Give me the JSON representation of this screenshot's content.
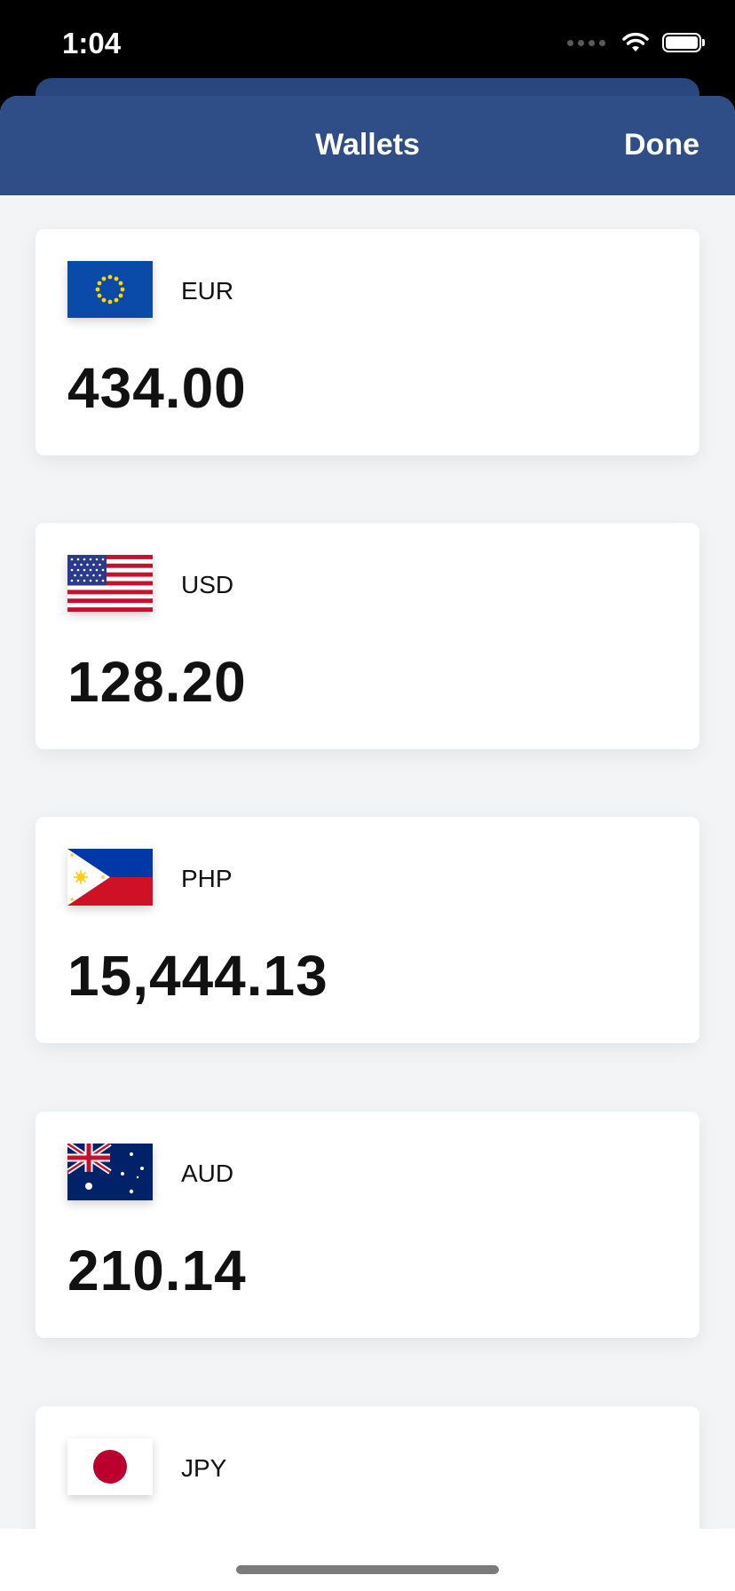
{
  "status_bar": {
    "time": "1:04",
    "icons": [
      "signal-icon",
      "wifi-icon",
      "battery-icon"
    ]
  },
  "nav": {
    "title": "Wallets",
    "done_label": "Done",
    "color": "#2f4e87"
  },
  "wallets": [
    {
      "code": "EUR",
      "amount": "434.00",
      "flag": "eu-flag-icon"
    },
    {
      "code": "USD",
      "amount": "128.20",
      "flag": "us-flag-icon"
    },
    {
      "code": "PHP",
      "amount": "15,444.13",
      "flag": "ph-flag-icon"
    },
    {
      "code": "AUD",
      "amount": "210.14",
      "flag": "au-flag-icon"
    },
    {
      "code": "JPY",
      "amount": "",
      "flag": "jp-flag-icon"
    }
  ]
}
